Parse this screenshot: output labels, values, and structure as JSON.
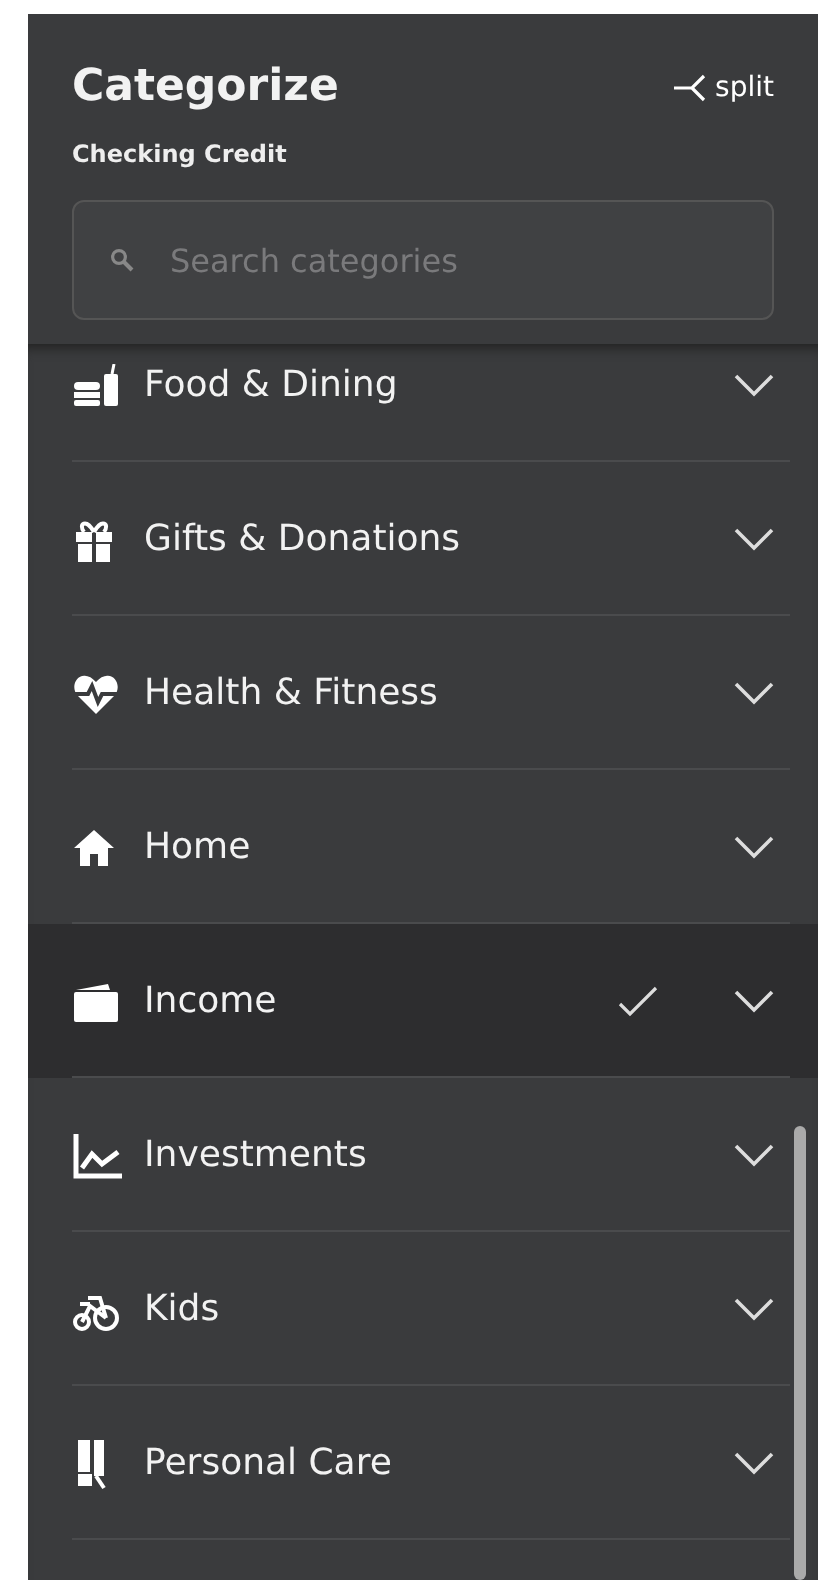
{
  "header": {
    "title": "Categorize",
    "split_label": "split",
    "account": "Checking Credit"
  },
  "search": {
    "placeholder": "Search categories"
  },
  "categories": [
    {
      "label": "Food & Dining",
      "selected": false
    },
    {
      "label": "Gifts & Donations",
      "selected": false
    },
    {
      "label": "Health & Fitness",
      "selected": false
    },
    {
      "label": "Home",
      "selected": false
    },
    {
      "label": "Income",
      "selected": true
    },
    {
      "label": "Investments",
      "selected": false
    },
    {
      "label": "Kids",
      "selected": false
    },
    {
      "label": "Personal Care",
      "selected": false
    }
  ]
}
